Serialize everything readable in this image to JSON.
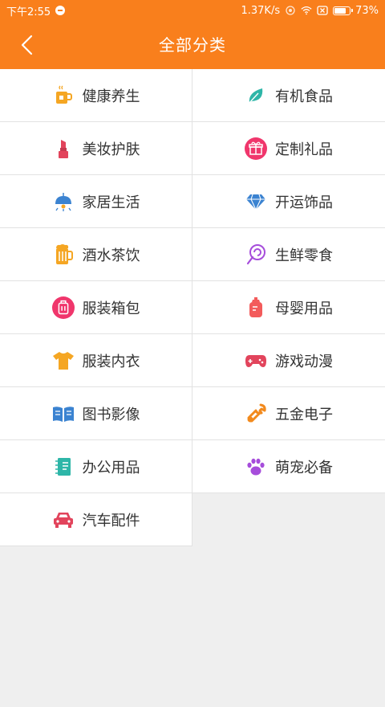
{
  "status": {
    "time": "下午2:55",
    "speed": "1.37K/s",
    "battery": "73%"
  },
  "header": {
    "title": "全部分类"
  },
  "categories": [
    {
      "label": "健康养生",
      "icon": "tea-cup-icon",
      "color": "#f5a623"
    },
    {
      "label": "有机食品",
      "icon": "leaf-icon",
      "color": "#2eb6a8"
    },
    {
      "label": "美妆护肤",
      "icon": "lipstick-icon",
      "color": "#e2445c"
    },
    {
      "label": "定制礼品",
      "icon": "gift-icon",
      "color": "#f0366c"
    },
    {
      "label": "家居生活",
      "icon": "lamp-icon",
      "color": "#3b83d1"
    },
    {
      "label": "开运饰品",
      "icon": "diamond-icon",
      "color": "#3b83d1"
    },
    {
      "label": "酒水茶饮",
      "icon": "beer-icon",
      "color": "#f5a623"
    },
    {
      "label": "生鲜零食",
      "icon": "lollipop-icon",
      "color": "#a64ddb"
    },
    {
      "label": "服装箱包",
      "icon": "suitcase-icon",
      "color": "#f0366c"
    },
    {
      "label": "母婴用品",
      "icon": "baby-bottle-icon",
      "color": "#f35b5b"
    },
    {
      "label": "服装内衣",
      "icon": "tshirt-icon",
      "color": "#f5a623"
    },
    {
      "label": "游戏动漫",
      "icon": "gamepad-icon",
      "color": "#e2445c"
    },
    {
      "label": "图书影像",
      "icon": "book-icon",
      "color": "#3b83d1"
    },
    {
      "label": "五金电子",
      "icon": "wrench-icon",
      "color": "#f28a1d"
    },
    {
      "label": "办公用品",
      "icon": "notebook-icon",
      "color": "#2eb6a8"
    },
    {
      "label": "萌宠必备",
      "icon": "paw-icon",
      "color": "#a64ddb"
    },
    {
      "label": "汽车配件",
      "icon": "car-icon",
      "color": "#e2445c"
    }
  ]
}
